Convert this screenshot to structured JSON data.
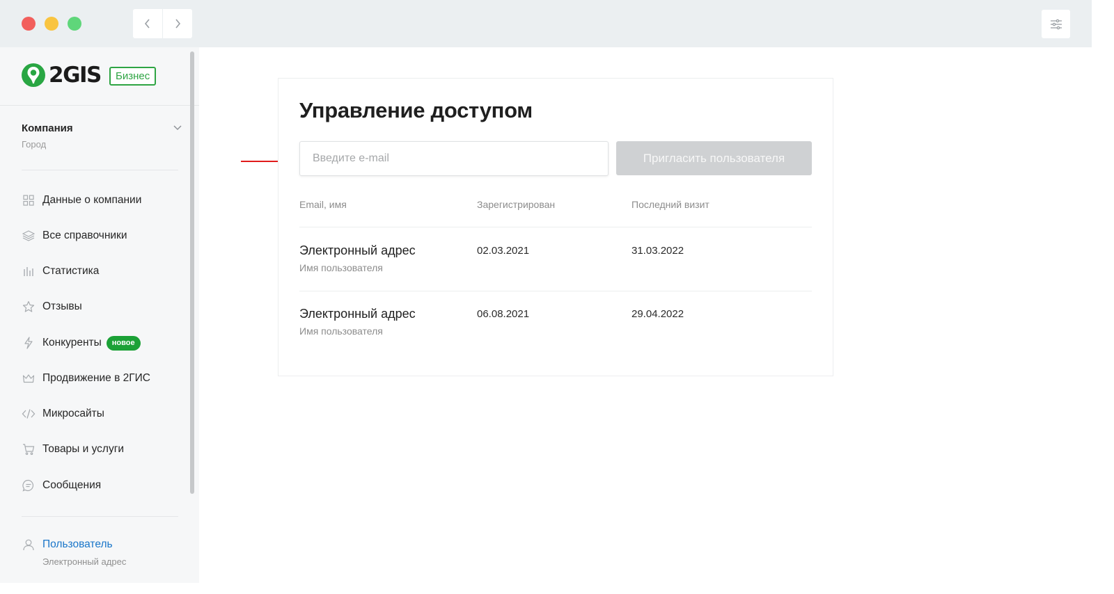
{
  "window": {
    "traffic_lights": {
      "close": "#f25f5c",
      "minimize": "#f9c440",
      "maximize": "#5fd67a"
    },
    "back_icon": "chevron-left-icon",
    "forward_icon": "chevron-right-icon",
    "settings_icon": "sliders-icon"
  },
  "brand": {
    "logo_text": "2GIS",
    "badge": "Бизнес",
    "accent_color": "#2ea443"
  },
  "sidebar": {
    "company": {
      "name": "Компания",
      "city": "Город"
    },
    "items": [
      {
        "label": "Данные о компании",
        "icon": "grid-icon"
      },
      {
        "label": "Все справочники",
        "icon": "layers-icon"
      },
      {
        "label": "Статистика",
        "icon": "bar-chart-icon"
      },
      {
        "label": "Отзывы",
        "icon": "star-icon"
      },
      {
        "label": "Конкуренты",
        "icon": "lightning-icon",
        "badge": "новое"
      },
      {
        "label": "Продвижение в 2ГИС",
        "icon": "crown-icon"
      },
      {
        "label": "Микросайты",
        "icon": "code-icon"
      },
      {
        "label": "Товары и услуги",
        "icon": "cart-icon"
      },
      {
        "label": "Сообщения",
        "icon": "chat-icon"
      }
    ],
    "user": {
      "name": "Пользователь",
      "email": "Электронный адрес",
      "icon": "user-icon",
      "color": "#1a76c9"
    }
  },
  "main": {
    "title": "Управление доступом",
    "email_placeholder": "Введите e-mail",
    "email_value": "",
    "invite_button": "Пригласить пользователя",
    "table": {
      "headers": [
        "Email, имя",
        "Зарегистрирован",
        "Последний визит"
      ],
      "rows": [
        {
          "email": "Электронный адрес",
          "name": "Имя пользователя",
          "registered": "02.03.2021",
          "last_visit": "31.03.2022"
        },
        {
          "email": "Электронный адрес",
          "name": "Имя пользователя",
          "registered": "06.08.2021",
          "last_visit": "29.04.2022"
        }
      ]
    }
  },
  "annotation": {
    "arrow_color": "#e01b1b"
  }
}
